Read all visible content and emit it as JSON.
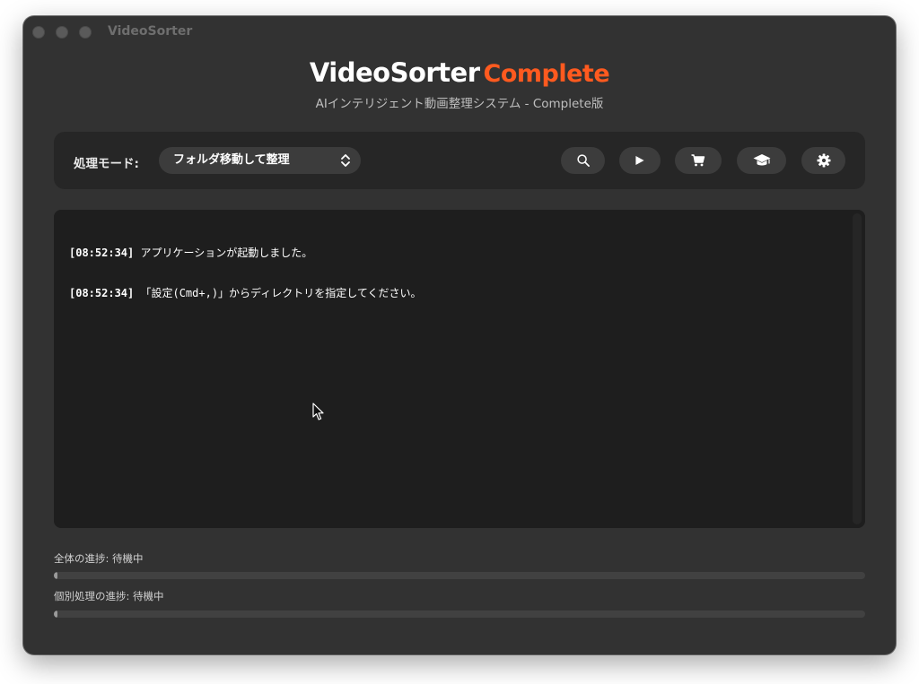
{
  "window": {
    "title": "VideoSorter"
  },
  "header": {
    "title": "VideoSorter",
    "title_accent": "Complete",
    "subtitle": "AIインテリジェント動画整理システム - Complete版"
  },
  "toolbar": {
    "mode_label": "処理モード:",
    "mode_value": "フォルダ移動して整理",
    "buttons": [
      {
        "icon": "search-icon"
      },
      {
        "icon": "play-icon"
      },
      {
        "icon": "cart-icon"
      },
      {
        "icon": "graduation-cap-icon"
      },
      {
        "icon": "gear-icon"
      }
    ]
  },
  "log": {
    "lines": [
      {
        "time": "[08:52:34]",
        "message": " アプリケーションが起動しました。"
      },
      {
        "time": "[08:52:34]",
        "message": " 「設定(Cmd+,)」からディレクトリを指定してください。"
      }
    ]
  },
  "progress": {
    "overall_label": "全体の進捗: 待機中",
    "overall_value": 0,
    "item_label": "個別処理の進捗: 待機中",
    "item_value": 0
  },
  "colors": {
    "accent": "#ff5a1f",
    "window_bg": "#323232",
    "panel_bg": "#262626",
    "log_bg": "#1e1e1e"
  }
}
